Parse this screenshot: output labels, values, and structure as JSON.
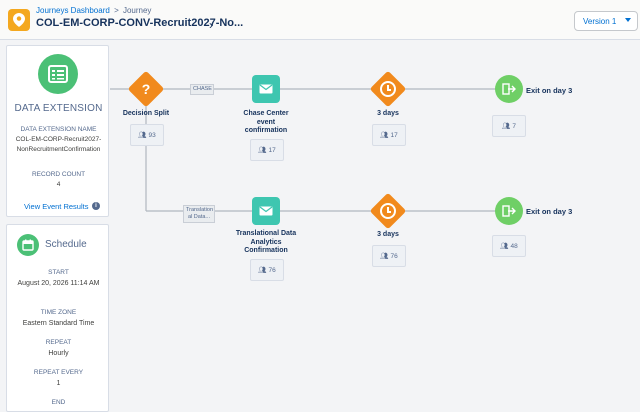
{
  "header": {
    "breadcrumb": [
      "Journeys Dashboard",
      ">",
      "Journey"
    ],
    "title": "COL-EM-CORP-CONV-Recruit2027-No...",
    "version": "Version 1"
  },
  "data_extension": {
    "title": "DATA EXTENSION",
    "name_label": "DATA EXTENSION NAME",
    "name_value": "COL-EM-CORP-Recruit2027-NonRecruitmentConfirmation",
    "count_label": "RECORD COUNT",
    "count_value": "4",
    "link": "View Event Results"
  },
  "schedule": {
    "title": "Schedule",
    "start_label": "START",
    "start_value": "August 20, 2026 11:14 AM",
    "tz_label": "TIME ZONE",
    "tz_value": "Eastern Standard Time",
    "repeat_label": "REPEAT",
    "repeat_value": "Hourly",
    "every_label": "REPEAT EVERY",
    "every_value": "1",
    "end_label": "END"
  },
  "canvas": {
    "decision": {
      "label": "Decision Split",
      "count": "93"
    },
    "path1_tag": "CHASE",
    "path2_tag": "Translation al Data...",
    "email1": {
      "label": "Chase Center event confirmation",
      "count": "17"
    },
    "wait1": {
      "label": "3 days",
      "count": "17"
    },
    "exit1": {
      "label": "Exit on day 3",
      "count": "7"
    },
    "email2": {
      "label": "Translational Data Analytics Confirmation",
      "count": "76"
    },
    "wait2": {
      "label": "3 days",
      "count": "76"
    },
    "exit2": {
      "label": "Exit on day 3",
      "count": "48"
    }
  },
  "colors": {
    "decision": "#f18a1d",
    "wait": "#f18a1d",
    "email": "#3ec6b0",
    "exit": "#6fcf66",
    "green": "#4bc076"
  }
}
